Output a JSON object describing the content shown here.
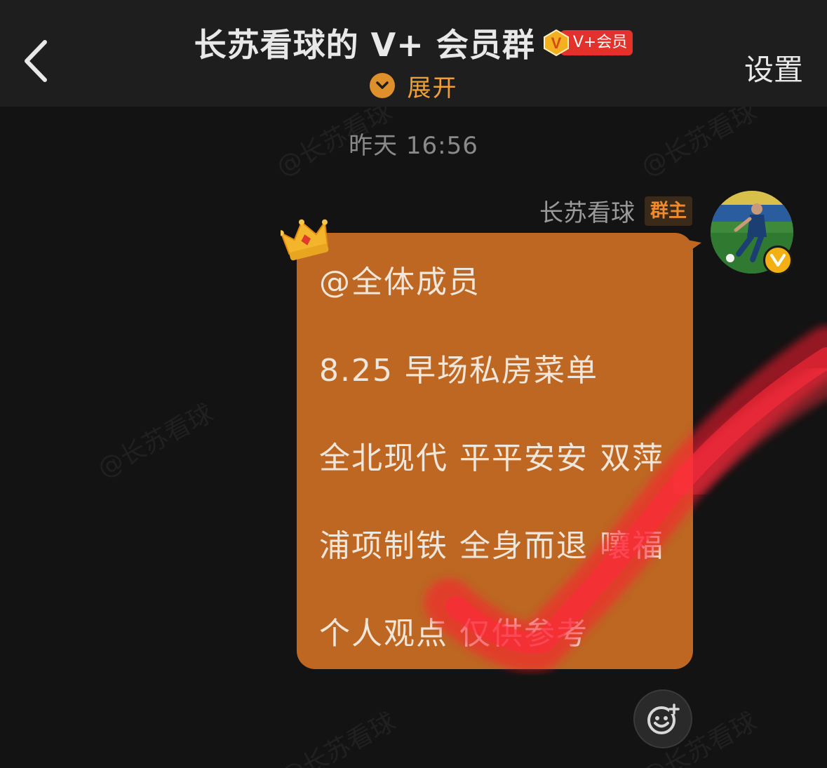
{
  "header": {
    "title": "长苏看球的 V+ 会员群",
    "vip_badge_label": "V+会员",
    "expand_label": "展开",
    "settings_label": "设置"
  },
  "watermark_text": "@长苏看球",
  "chat": {
    "timestamp": "昨天 16:56",
    "sender_name": "长苏看球",
    "sender_role": "群主",
    "message_lines": [
      "@全体成员",
      "8.25 早场私房菜单",
      "全北现代  平平安安  双萍",
      "浦项制铁  全身而退  嚷福",
      "个人观点  仅供参考"
    ]
  },
  "colors": {
    "bubble": "#bd6723",
    "accent": "#f0a03a",
    "badge_red": "#e3322b",
    "role_text": "#f08a2a"
  },
  "icons": {
    "back": "chevron-left-icon",
    "expand": "chevron-down-icon",
    "crown": "crown-icon",
    "verified": "v-verified-icon",
    "sticker": "smiley-add-icon"
  }
}
